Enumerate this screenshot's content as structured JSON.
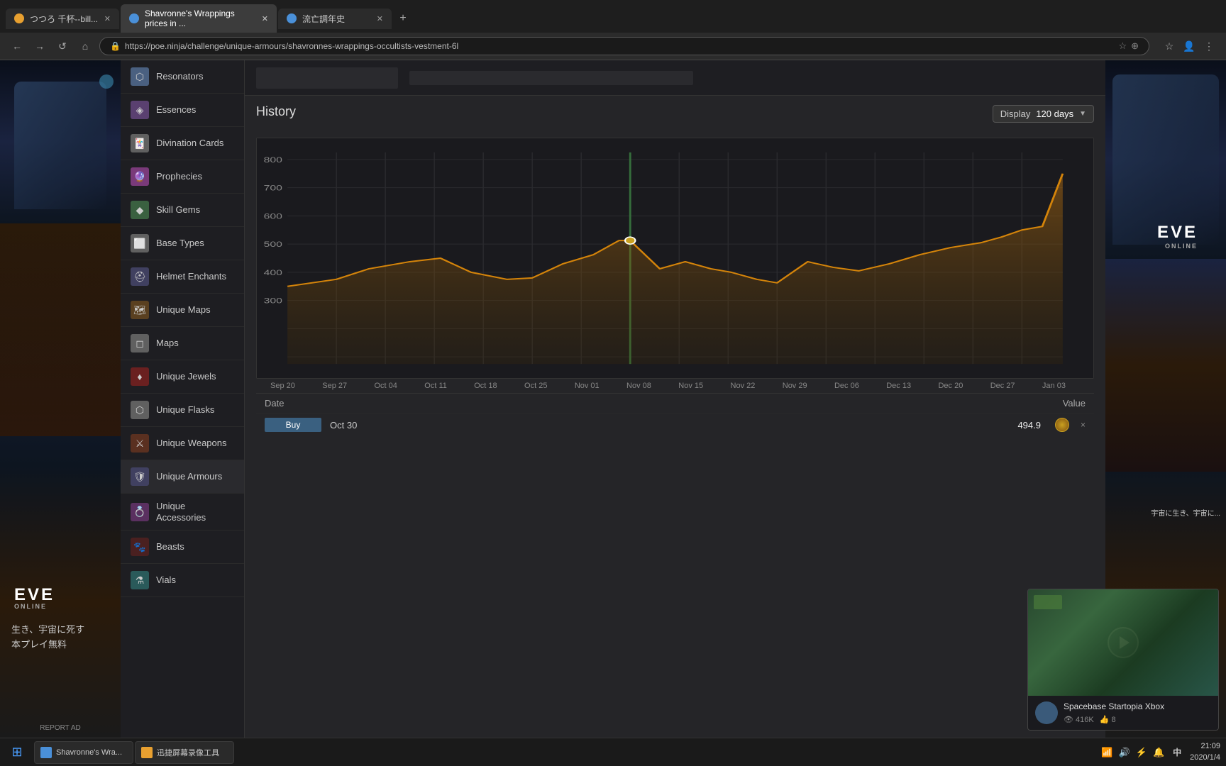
{
  "browser": {
    "tabs": [
      {
        "id": "tab1",
        "label": "つつろ 千杯--bill...",
        "active": false,
        "icon_color": "#e8a030"
      },
      {
        "id": "tab2",
        "label": "Shavronne's Wrappings prices in ...",
        "active": true,
        "icon_color": "#4a90d9"
      },
      {
        "id": "tab3",
        "label": "流亡調年史",
        "active": false,
        "icon_color": "#4a90d9"
      }
    ],
    "url": "https://poe.ninja/challenge/unique-armours/shavronnes-wrappings-occultists-vestment-6l",
    "nav": {
      "back": "←",
      "forward": "→",
      "refresh": "↺",
      "home": "⌂"
    }
  },
  "sidebar": {
    "items": [
      {
        "id": "resonators",
        "label": "Resonators",
        "icon": "⬡",
        "icon_class": "icon-resonators"
      },
      {
        "id": "essences",
        "label": "Essences",
        "icon": "◈",
        "icon_class": "icon-essences"
      },
      {
        "id": "divination-cards",
        "label": "Divination Cards",
        "icon": "🃏",
        "icon_class": "icon-divination"
      },
      {
        "id": "prophecies",
        "label": "Prophecies",
        "icon": "🔮",
        "icon_class": "icon-prophecies"
      },
      {
        "id": "skill-gems",
        "label": "Skill Gems",
        "icon": "◆",
        "icon_class": "icon-skill-gems"
      },
      {
        "id": "base-types",
        "label": "Base Types",
        "icon": "⬜",
        "icon_class": "icon-base-types"
      },
      {
        "id": "helmet-enchants",
        "label": "Helmet Enchants",
        "icon": "⛑",
        "icon_class": "icon-helmet"
      },
      {
        "id": "unique-maps",
        "label": "Unique Maps",
        "icon": "🗺",
        "icon_class": "icon-unique-maps"
      },
      {
        "id": "maps",
        "label": "Maps",
        "icon": "◻",
        "icon_class": "icon-maps"
      },
      {
        "id": "unique-jewels",
        "label": "Unique Jewels",
        "icon": "♦",
        "icon_class": "icon-unique-jewels"
      },
      {
        "id": "unique-flasks",
        "label": "Unique Flasks",
        "icon": "⬡",
        "icon_class": "icon-unique-flasks"
      },
      {
        "id": "unique-weapons",
        "label": "Unique Weapons",
        "icon": "⚔",
        "icon_class": "icon-unique-weapons"
      },
      {
        "id": "unique-armours",
        "label": "Unique Armours",
        "icon": "🛡",
        "icon_class": "icon-unique-armours",
        "active": true
      },
      {
        "id": "unique-accessories",
        "label": "Unique Accessories",
        "icon": "💍",
        "icon_class": "icon-unique-accessories"
      },
      {
        "id": "beasts",
        "label": "Beasts",
        "icon": "🐾",
        "icon_class": "icon-beasts"
      },
      {
        "id": "vials",
        "label": "Vials",
        "icon": "⚗",
        "icon_class": "icon-vials"
      }
    ]
  },
  "history": {
    "title": "History",
    "display_label": "Display",
    "display_value": "120 days",
    "x_labels": [
      "Sep 20",
      "Sep 27",
      "Oct 04",
      "Oct 11",
      "Oct 18",
      "Oct 25",
      "Nov 01",
      "Nov 08",
      "Nov 15",
      "Nov 22",
      "Nov 29",
      "Dec 06",
      "Dec 13",
      "Dec 20",
      "Dec 27",
      "Jan 03"
    ],
    "y_labels": [
      "800",
      "700",
      "600",
      "500",
      "400",
      "300"
    ],
    "table_headers": {
      "date": "Date",
      "value": "Value"
    },
    "data_row": {
      "type": "Buy",
      "date": "Oct 30",
      "value": "494.9",
      "close": "×"
    }
  },
  "video_widget": {
    "title": "Spacebase Startopia Xbox",
    "views": "416K",
    "likes": "8",
    "view_icon": "👁",
    "like_icon": "👍"
  },
  "taskbar": {
    "apps": [
      {
        "label": "Shavronne's Wra...",
        "icon_color": "#4a90d9"
      },
      {
        "label": "迅捷屏幕录像工具",
        "icon_color": "#e8a030"
      }
    ],
    "right_icons": [
      "🔊",
      "📶",
      "⚡",
      "🔔"
    ],
    "time": "21:09",
    "date": "2020/1/4",
    "lang": "中"
  },
  "left_ad": {
    "eve_logo": "EVE",
    "eve_subtitle": "ONLINE",
    "jp_line1": "生き、宇宙に死す",
    "jp_line2": "本プレイ無料",
    "report_ad": "REPORT AD"
  },
  "right_ad": {
    "eve_logo": "EVE",
    "eve_subtitle": "ONLINE",
    "jp_text": "宇宙に生き、宇宙に..."
  },
  "chart": {
    "highlight_x": 0.435,
    "data_points": [
      [
        0.0,
        0.42
      ],
      [
        0.04,
        0.44
      ],
      [
        0.07,
        0.48
      ],
      [
        0.1,
        0.5
      ],
      [
        0.13,
        0.52
      ],
      [
        0.16,
        0.45
      ],
      [
        0.19,
        0.42
      ],
      [
        0.22,
        0.44
      ],
      [
        0.25,
        0.43
      ],
      [
        0.28,
        0.54
      ],
      [
        0.31,
        0.55
      ],
      [
        0.34,
        0.58
      ],
      [
        0.37,
        0.6
      ],
      [
        0.4,
        0.62
      ],
      [
        0.435,
        0.62
      ],
      [
        0.46,
        0.48
      ],
      [
        0.49,
        0.52
      ],
      [
        0.52,
        0.5
      ],
      [
        0.55,
        0.46
      ],
      [
        0.58,
        0.44
      ],
      [
        0.61,
        0.43
      ],
      [
        0.64,
        0.56
      ],
      [
        0.67,
        0.52
      ],
      [
        0.7,
        0.5
      ],
      [
        0.73,
        0.54
      ],
      [
        0.76,
        0.56
      ],
      [
        0.79,
        0.58
      ],
      [
        0.82,
        0.62
      ],
      [
        0.85,
        0.64
      ],
      [
        0.88,
        0.66
      ],
      [
        0.91,
        0.68
      ],
      [
        0.94,
        0.65
      ],
      [
        0.97,
        0.7
      ],
      [
        1.0,
        0.8
      ]
    ]
  }
}
